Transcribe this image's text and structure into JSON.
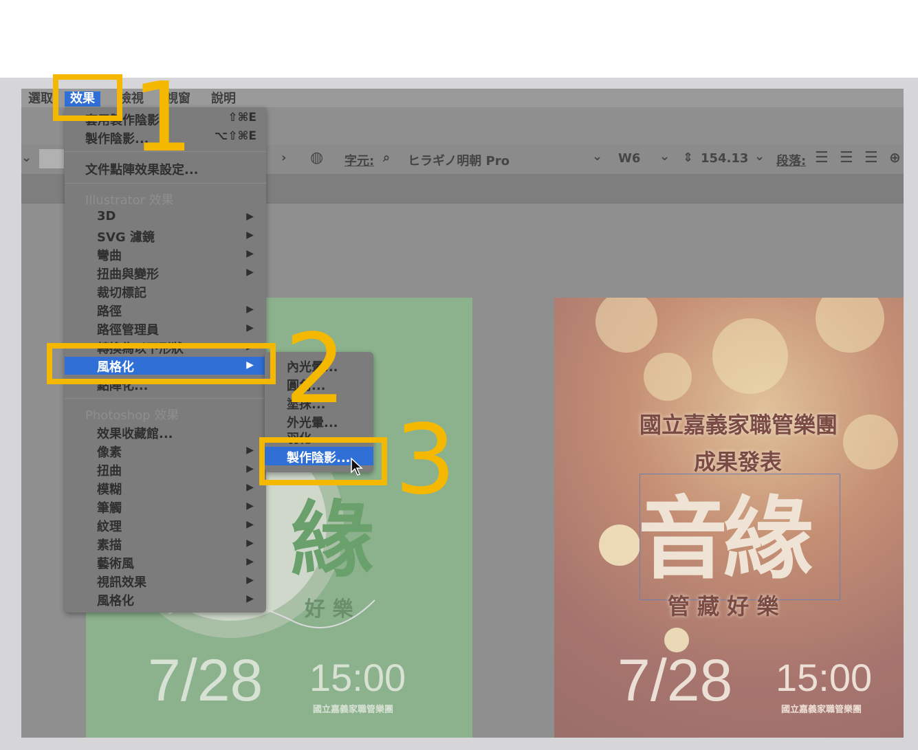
{
  "menubar": {
    "items": [
      {
        "label": "選取",
        "active": false
      },
      {
        "label": "效果",
        "active": true
      },
      {
        "label": "檢視",
        "active": false
      },
      {
        "label": "視窗",
        "active": false
      },
      {
        "label": "說明",
        "active": false
      }
    ]
  },
  "toolbar": {
    "character_label": "字元:",
    "font_name": "ヒラギノ明朝 Pro",
    "weight": "W6",
    "size": "154.13",
    "paragraph_label": "段落:"
  },
  "effect_menu": {
    "apply_last": {
      "label": "套用製作陰影",
      "shortcut": "⇧⌘E"
    },
    "last_effect": {
      "label": "製作陰影...",
      "shortcut": "⌥⇧⌘E"
    },
    "doc_raster": "文件點陣效果設定...",
    "illustrator_header": "Illustrator 效果",
    "illustrator_items": [
      {
        "label": "3D",
        "arrow": true
      },
      {
        "label": "SVG 濾鏡",
        "arrow": true
      },
      {
        "label": "彎曲",
        "arrow": true
      },
      {
        "label": "扭曲與變形",
        "arrow": true
      },
      {
        "label": "裁切標記",
        "arrow": false
      },
      {
        "label": "路徑",
        "arrow": true
      },
      {
        "label": "路徑管理員",
        "arrow": true
      },
      {
        "label": "轉換為以下形狀",
        "arrow": true
      },
      {
        "label": "風格化",
        "arrow": true,
        "highlight": true
      },
      {
        "label": "點陣化...",
        "arrow": false
      }
    ],
    "photoshop_header": "Photoshop 效果",
    "photoshop_items": [
      {
        "label": "效果收藏館...",
        "arrow": false
      },
      {
        "label": "像素",
        "arrow": true
      },
      {
        "label": "扭曲",
        "arrow": true
      },
      {
        "label": "模糊",
        "arrow": true
      },
      {
        "label": "筆觸",
        "arrow": true
      },
      {
        "label": "紋理",
        "arrow": true
      },
      {
        "label": "素描",
        "arrow": true
      },
      {
        "label": "藝術風",
        "arrow": true
      },
      {
        "label": "視訊效果",
        "arrow": true
      },
      {
        "label": "風格化",
        "arrow": true
      }
    ]
  },
  "stylize_submenu": {
    "items": [
      {
        "label": "內光暈..."
      },
      {
        "label": "圓角..."
      },
      {
        "label": "塗抹..."
      },
      {
        "label": "外光暈..."
      },
      {
        "label": "羽化..."
      },
      {
        "label": "製作陰影...",
        "highlight": true
      }
    ]
  },
  "poster_left": {
    "big_char": "緣",
    "subtitle": "好 樂",
    "date": "7/28",
    "time": "15:00",
    "org": "國立嘉義家職管樂團"
  },
  "poster_right": {
    "org_line": "國立嘉義家職管樂團",
    "event": "成果發表",
    "title": "音緣",
    "subtitle": "管 藏 好 樂",
    "date": "7/28",
    "time": "15:00",
    "org": "國立嘉義家職管樂團"
  },
  "callouts": {
    "step1": "1",
    "step2": "2",
    "step3": "3"
  },
  "colors": {
    "callout": "#f5b800",
    "menu_highlight": "#2f6fd6"
  }
}
